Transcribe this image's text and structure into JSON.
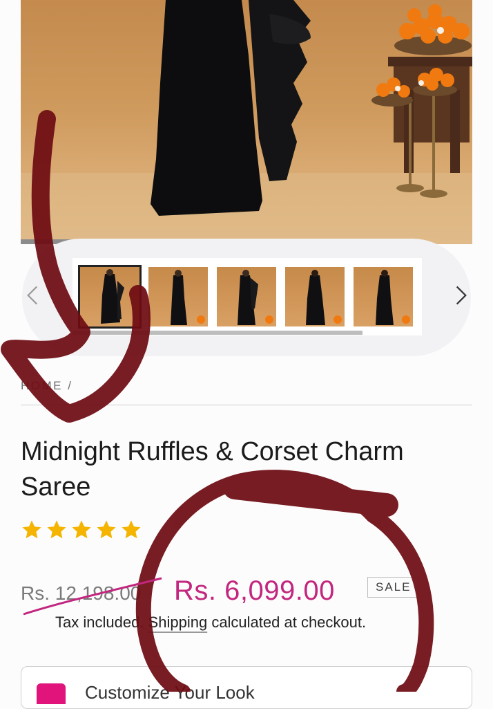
{
  "gallery": {
    "thumbnails": [
      {
        "label": "thumbnail-1",
        "active": true
      },
      {
        "label": "thumbnail-2",
        "active": false
      },
      {
        "label": "thumbnail-3",
        "active": false
      },
      {
        "label": "thumbnail-4",
        "active": false
      },
      {
        "label": "thumbnail-5",
        "active": false
      }
    ],
    "prev_icon": "chevron-left-icon",
    "next_icon": "chevron-right-icon"
  },
  "breadcrumb": {
    "home": "HOME",
    "separator": "/"
  },
  "product": {
    "title": "Midnight Ruffles & Corset Charm Saree",
    "rating": {
      "stars": 5,
      "max": 5
    },
    "old_price": "Rs. 12,198.00",
    "price": "Rs. 6,099.00",
    "badge": "SALE",
    "tax_prefix": "Tax included.",
    "shipping_link": "Shipping",
    "tax_suffix": "calculated at checkout."
  },
  "customize": {
    "label": "Customize Your Look"
  },
  "colors": {
    "accent": "#c2267e",
    "star": "#f4b400",
    "ink": "#7a0f14",
    "brand": "#e0147a"
  }
}
